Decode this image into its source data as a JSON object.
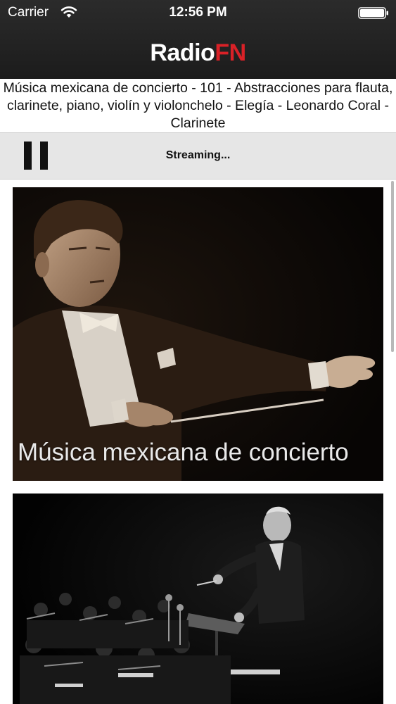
{
  "status_bar": {
    "carrier": "Carrier",
    "time": "12:56 PM",
    "wifi_icon": "wifi-icon",
    "battery_icon": "battery-icon"
  },
  "nav_bar": {
    "logo_part1": "Radio",
    "logo_part2": "FN",
    "logo_color_primary": "#ffffff",
    "logo_color_accent": "#d92127"
  },
  "now_playing": {
    "text": "Música mexicana de concierto - 101 - Abstracciones para flauta, clarinete, piano, violín y violonchelo - Elegía - Leonardo Coral - Clarinete"
  },
  "player": {
    "control_icon": "pause-icon",
    "status": "Streaming..."
  },
  "programs": [
    {
      "title": "Música mexicana de concierto",
      "image": "conductor-portrait-sepia"
    },
    {
      "title": "",
      "image": "conductor-with-orchestra-bw"
    }
  ]
}
